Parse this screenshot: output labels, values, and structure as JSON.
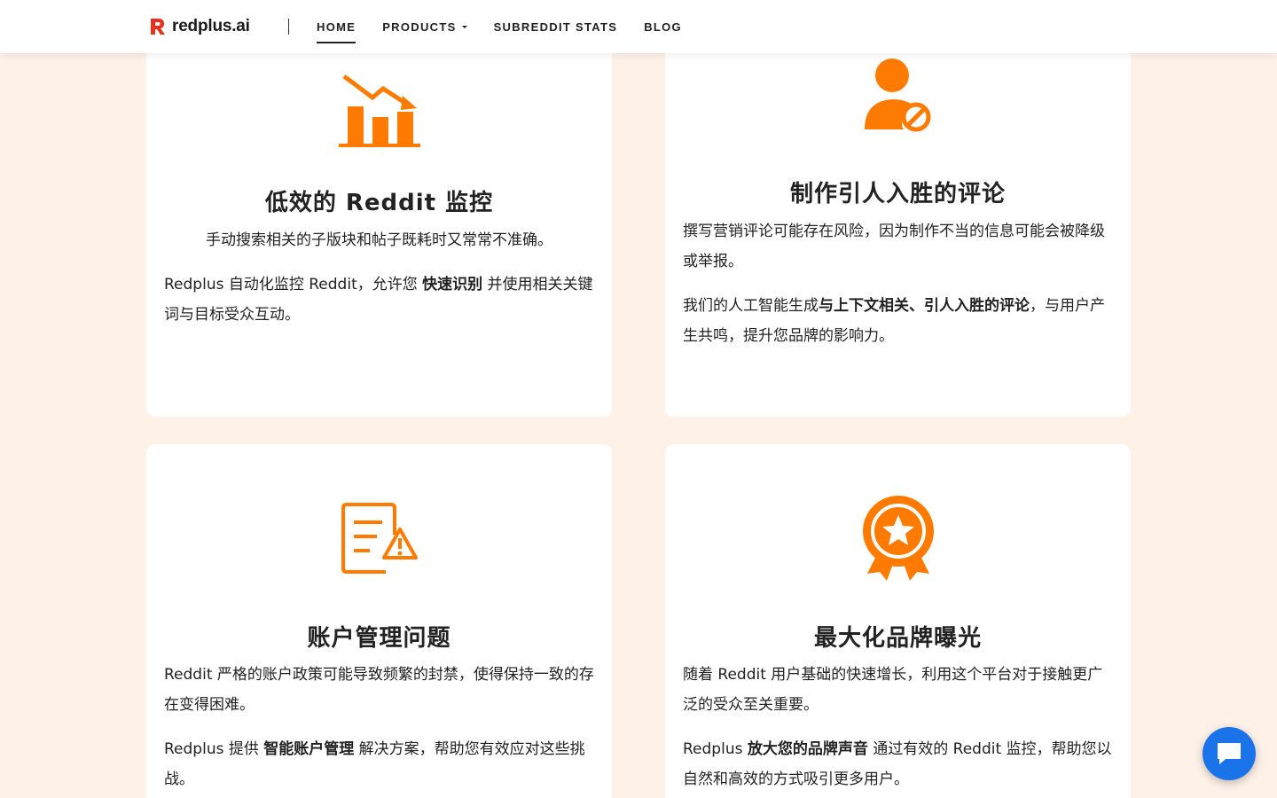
{
  "brand": {
    "name": "redplus.ai",
    "accent": "#ff7a00",
    "logo_red": "#e8301c"
  },
  "nav": {
    "items": [
      {
        "label": "HOME",
        "active": true
      },
      {
        "label": "PRODUCTS",
        "dropdown": true
      },
      {
        "label": "SUBREDDIT STATS"
      },
      {
        "label": "BLOG"
      }
    ]
  },
  "cards": [
    {
      "icon": "declining-chart-icon",
      "title": "低效的 Reddit 监控",
      "p1": "手动搜索相关的子版块和帖子既耗时又常常不准确。",
      "p2_pre": "Redplus 自动化监控 Reddit，允许您 ",
      "p2_bold": "快速识别",
      "p2_post": " 并使用相关关键词与目标受众互动。"
    },
    {
      "icon": "user-blocked-icon",
      "title": "制作引人入胜的评论",
      "p1": "撰写营销评论可能存在风险，因为制作不当的信息可能会被降级或举报。",
      "p2_pre": "我们的人工智能生成",
      "p2_bold": "与上下文相关、引人入胜的评论",
      "p2_post": "，与用户产生共鸣，提升您品牌的影响力。"
    },
    {
      "icon": "document-warning-icon",
      "title": "账户管理问题",
      "p1": "Reddit 严格的账户政策可能导致频繁的封禁，使得保持一致的存在变得困难。",
      "p2_pre": "Redplus 提供 ",
      "p2_bold": "智能账户管理",
      "p2_post": " 解决方案，帮助您有效应对这些挑战。"
    },
    {
      "icon": "award-badge-icon",
      "title": "最大化品牌曝光",
      "p1": "随着 Reddit 用户基础的快速增长，利用这个平台对于接触更广泛的受众至关重要。",
      "p2_pre": "Redplus ",
      "p2_bold": "放大您的品牌声音",
      "p2_post": " 通过有效的 Reddit 监控，帮助您以自然和高效的方式吸引更多用户。"
    }
  ],
  "chat": {
    "icon": "chat-bubble-icon",
    "color": "#1a73e8"
  }
}
